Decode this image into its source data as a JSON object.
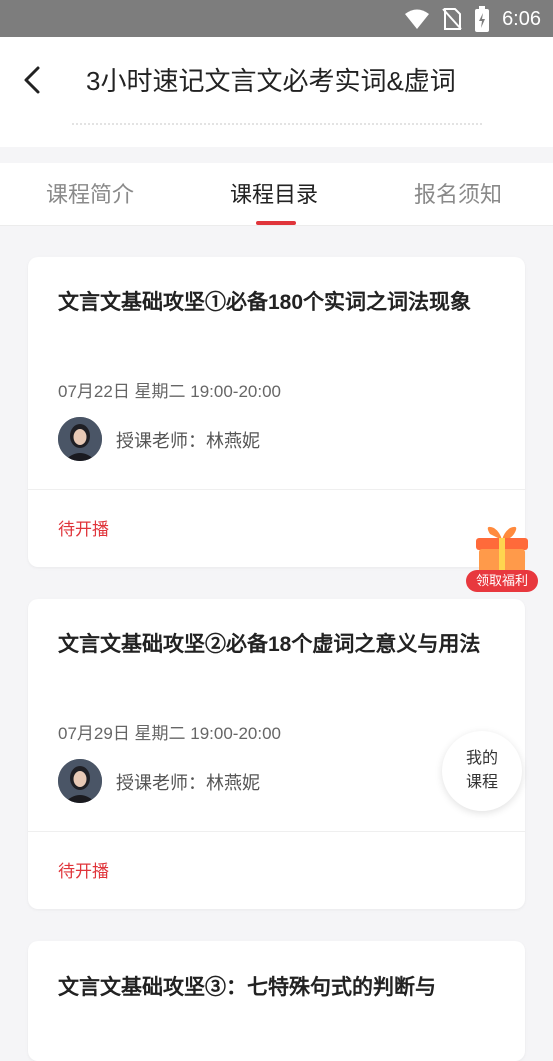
{
  "status_bar": {
    "time": "6:06"
  },
  "header": {
    "title": "3小时速记文言文必考实词&虚词"
  },
  "tabs": [
    {
      "label": "课程简介"
    },
    {
      "label": "课程目录"
    },
    {
      "label": "报名须知"
    }
  ],
  "courses": [
    {
      "title": "文言文基础攻坚①必备180个实词之词法现象",
      "date": "07月22日 星期二 19:00-20:00",
      "teacher": "授课老师：林燕妮",
      "status": "待开播"
    },
    {
      "title": "文言文基础攻坚②必备18个虚词之意义与用法",
      "date": "07月29日 星期二 19:00-20:00",
      "teacher": "授课老师：林燕妮",
      "status": "待开播"
    },
    {
      "title": "文言文基础攻坚③：七特殊句式的判断与"
    }
  ],
  "gift": {
    "label": "领取福利"
  },
  "my_course": {
    "line1": "我的",
    "line2": "课程"
  },
  "colors": {
    "accent": "#e0353b",
    "status_bar": "#7d7d7d"
  }
}
